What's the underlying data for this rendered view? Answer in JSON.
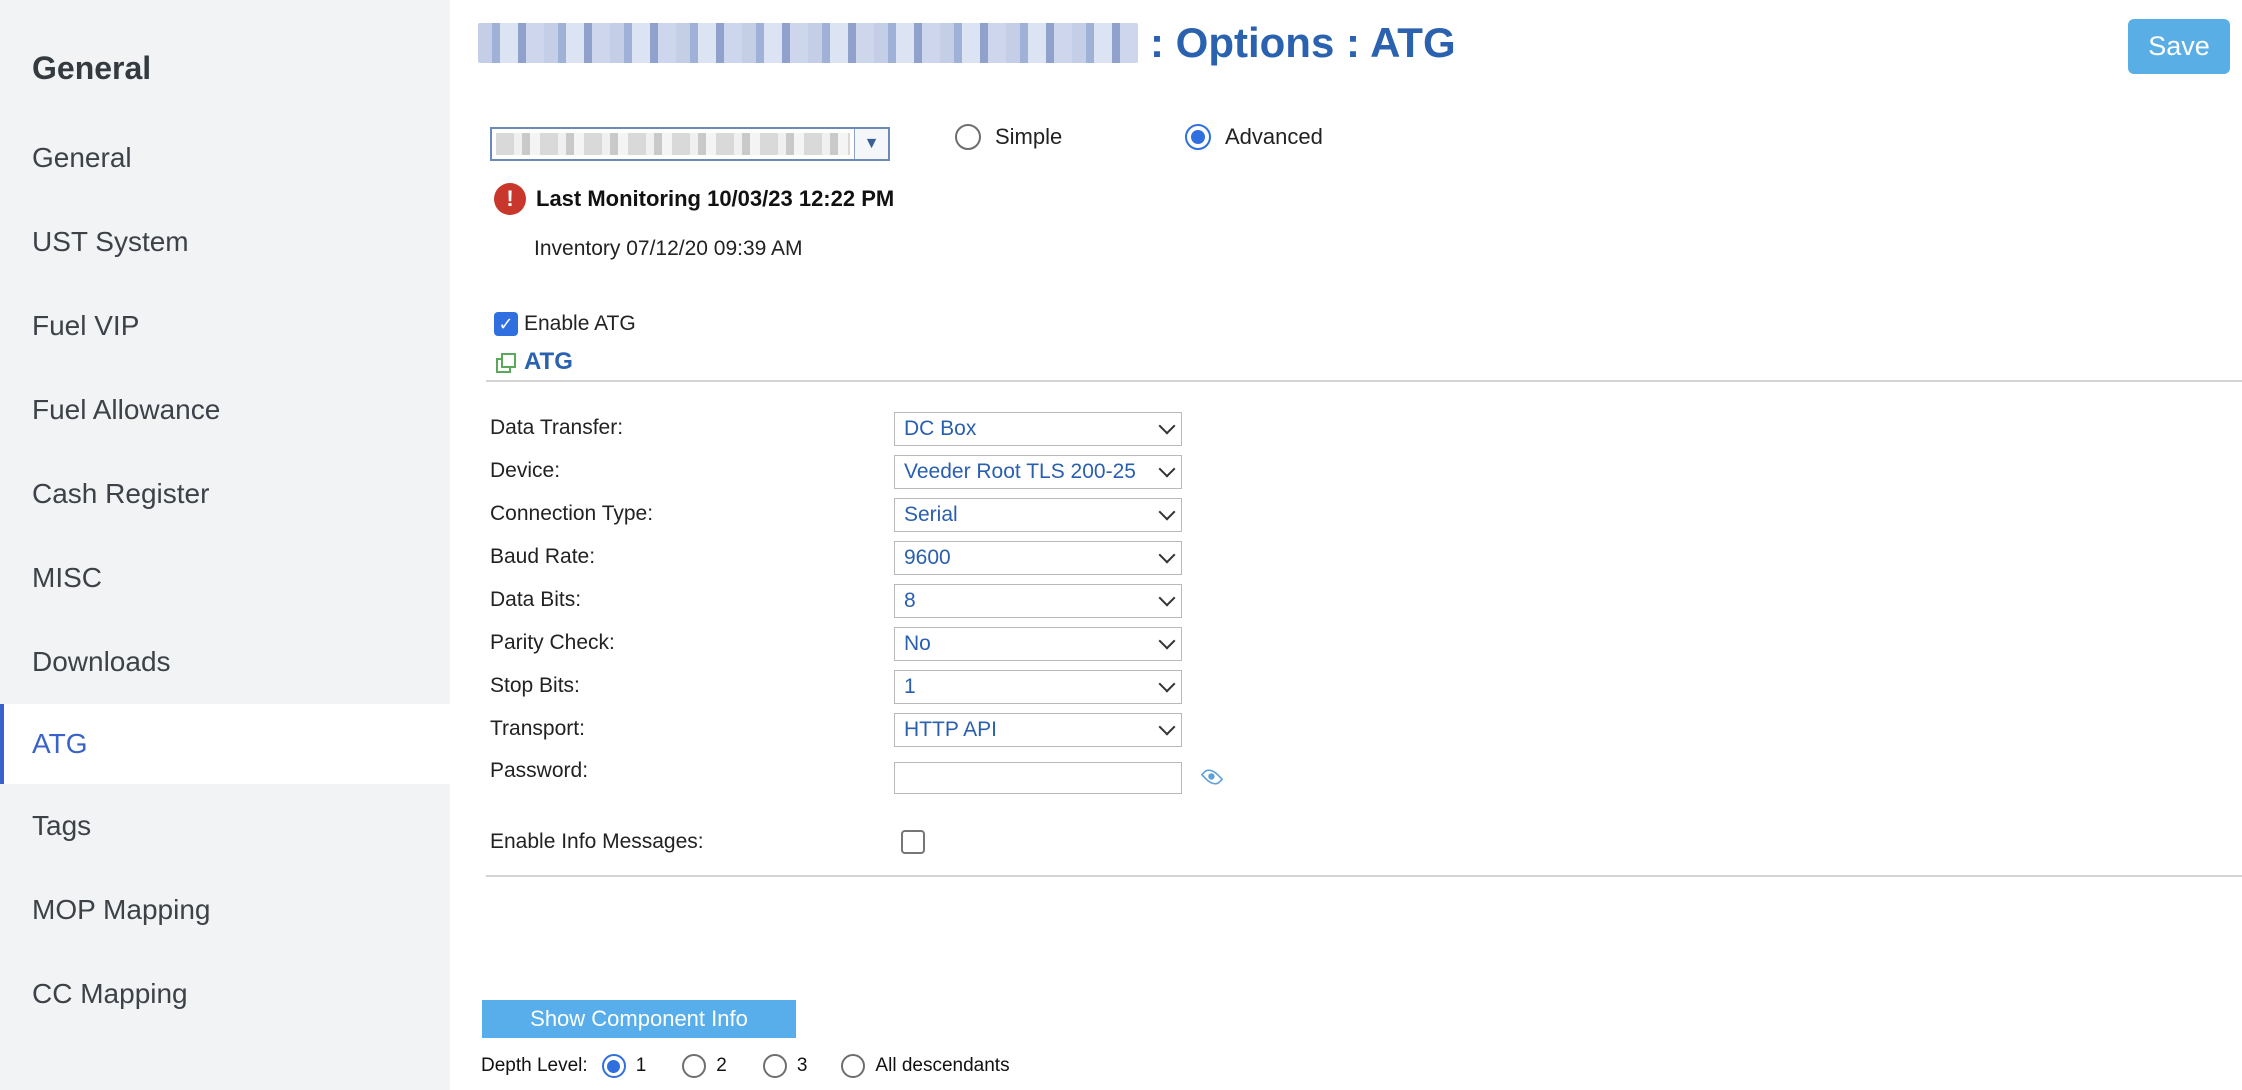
{
  "sidebar": {
    "heading": "General",
    "items": [
      {
        "label": "General"
      },
      {
        "label": "UST System"
      },
      {
        "label": "Fuel VIP"
      },
      {
        "label": "Fuel Allowance"
      },
      {
        "label": "Cash Register"
      },
      {
        "label": "MISC"
      },
      {
        "label": "Downloads"
      },
      {
        "label": "ATG",
        "active": true
      },
      {
        "label": "Tags"
      },
      {
        "label": "MOP Mapping"
      },
      {
        "label": "CC Mapping"
      }
    ]
  },
  "header": {
    "title_suffix": ": Options : ATG",
    "save_label": "Save"
  },
  "mode": {
    "options": [
      "Simple",
      "Advanced"
    ],
    "selected": "Advanced"
  },
  "status": {
    "last_monitoring": "Last Monitoring 10/03/23 12:22 PM",
    "inventory": "Inventory 07/12/20 09:39 AM"
  },
  "enable_atg": {
    "label": "Enable ATG",
    "checked": true
  },
  "section": {
    "title": "ATG"
  },
  "form": {
    "data_transfer": {
      "label": "Data Transfer:",
      "value": "DC Box"
    },
    "device": {
      "label": "Device:",
      "value": "Veeder Root TLS 200-25"
    },
    "connection_type": {
      "label": "Connection Type:",
      "value": "Serial"
    },
    "baud_rate": {
      "label": "Baud Rate:",
      "value": "9600"
    },
    "data_bits": {
      "label": "Data Bits:",
      "value": "8"
    },
    "parity_check": {
      "label": "Parity Check:",
      "value": "No"
    },
    "stop_bits": {
      "label": "Stop Bits:",
      "value": "1"
    },
    "transport": {
      "label": "Transport:",
      "value": "HTTP API"
    },
    "password": {
      "label": "Password:",
      "value": ""
    },
    "enable_info": {
      "label": "Enable Info Messages:",
      "checked": false
    }
  },
  "component": {
    "button_label": "Show Component Info",
    "depth_label": "Depth Level:",
    "depth_options": [
      "1",
      "2",
      "3",
      "All descendants"
    ],
    "depth_selected": "1"
  },
  "colors": {
    "accent": "#2a62b0",
    "save_button": "#5aaee6",
    "active_nav": "#3a63c9",
    "error": "#c9372c"
  }
}
